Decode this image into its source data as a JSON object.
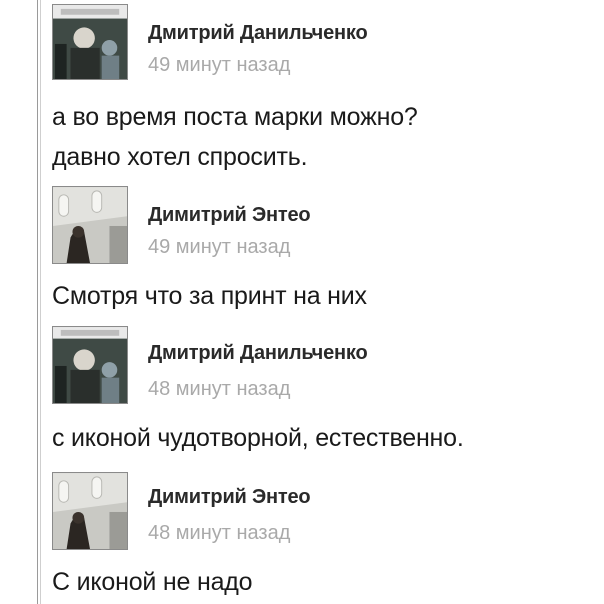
{
  "messages": [
    {
      "author": "Дмитрий Данильченко",
      "time": "49 минут назад",
      "text": "а во время поста марки можно?\nдавно хотел спросить."
    },
    {
      "author": "Димитрий Энтео",
      "time": "49 минут назад",
      "text": "Смотря что за принт на них"
    },
    {
      "author": "Дмитрий Данильченко",
      "time": "48 минут назад",
      "text": "с иконой чудотворной, естественно."
    },
    {
      "author": "Димитрий Энтео",
      "time": "48 минут назад",
      "text": "С иконой не надо"
    }
  ],
  "colors": {
    "author": "#2a2a2a",
    "timestamp": "#a9a9a9",
    "text": "#1a1a1a",
    "rule": "#9a9a9a"
  },
  "icons": [
    "user-avatar-photo",
    "user-avatar-church"
  ]
}
